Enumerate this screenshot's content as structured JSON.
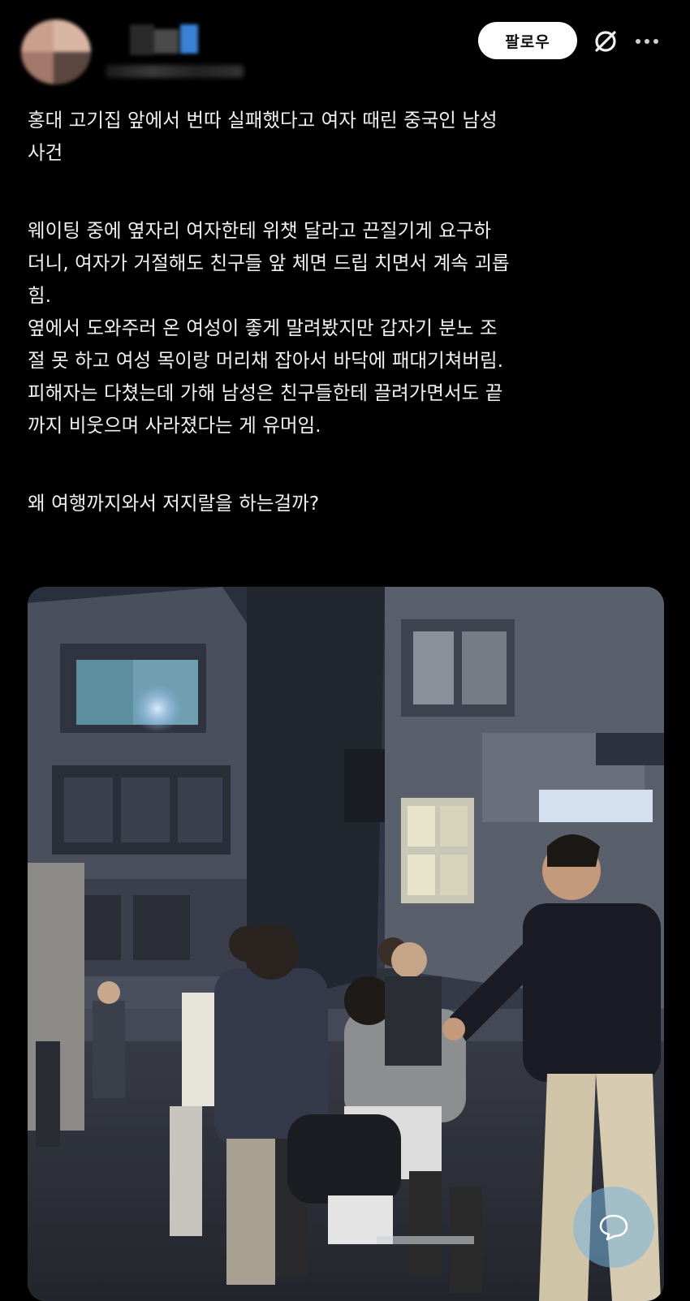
{
  "header": {
    "follow_label": "팔로우",
    "icons": {
      "avatar": "avatar-blurred",
      "slash": "circle-slash-icon",
      "more": "more-dots-icon"
    }
  },
  "post": {
    "paragraphs": [
      [
        "홍대 고기집 앞에서 번따 실패했다고 여자 때린 중국인 남성",
        "사건"
      ],
      [
        "웨이팅 중에 옆자리 여자한테 위챗 달라고 끈질기게 요구하",
        "더니, 여자가 거절해도 친구들 앞 체면 드립 치면서 계속 괴롭",
        "힘.",
        "옆에서 도와주러 온 여성이 좋게 말려봤지만 갑자기 분노 조",
        "절 못 하고 여성 목이랑 머리채 잡아서 바닥에 패대기쳐버림.",
        "피해자는 다쳤는데 가해 남성은 친구들한테 끌려가면서도 끝",
        "까지 비웃으며 사라졌다는 게 유머임."
      ],
      [
        "왜 여행까지와서 저지랄을 하는걸까?"
      ]
    ]
  },
  "media": {
    "type": "photo",
    "reply_icon": "speech-bubble-icon"
  },
  "colors": {
    "background": "#000000",
    "text": "#f0f0f0",
    "follow_bg": "#ffffff",
    "fab": "#7ab4dc"
  }
}
